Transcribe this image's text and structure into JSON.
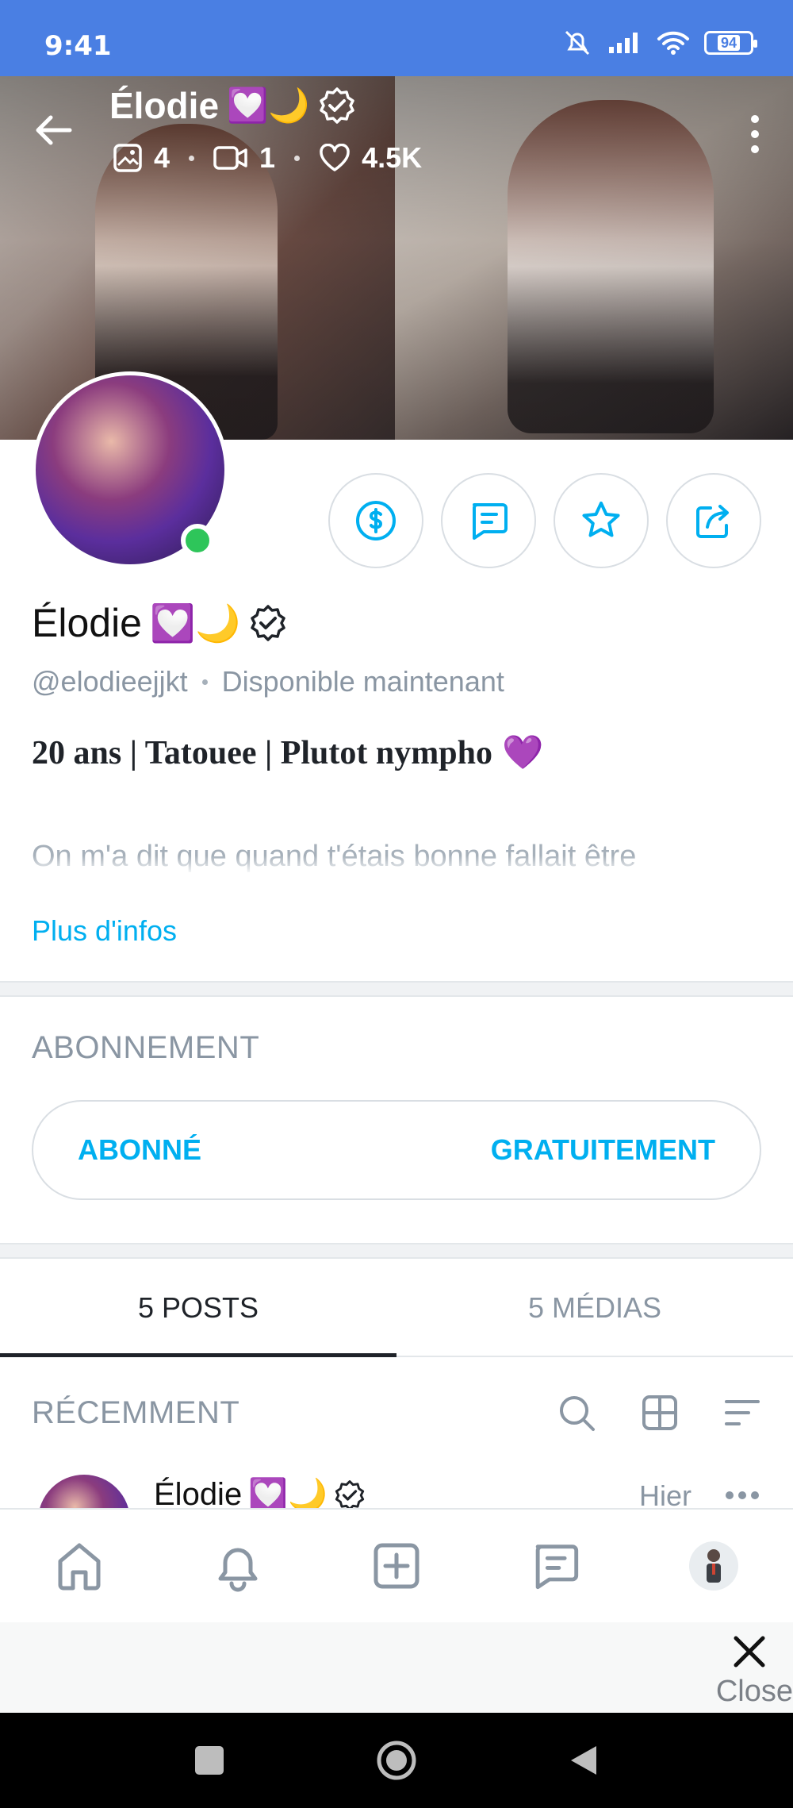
{
  "status_bar": {
    "time": "9:41",
    "battery": "94",
    "icons": [
      "mute-icon",
      "signal-icon",
      "wifi-icon",
      "battery-icon"
    ]
  },
  "cover": {
    "title_name": "Élodie",
    "title_emojis": "💟🌙",
    "stats": {
      "photos": "4",
      "videos": "1",
      "likes": "4.5K"
    }
  },
  "profile": {
    "name": "Élodie",
    "emojis": "💟🌙",
    "handle": "@elodieejjkt",
    "status": "Disponible maintenant",
    "bio_line1": "20 ans | Tatouee | Plutot nympho",
    "bio_emoji": "💜",
    "bio_line2": "On m'a dit que quand t'étais bonne fallait être",
    "more_info": "Plus d'infos"
  },
  "subscription": {
    "section_title": "ABONNEMENT",
    "left_label": "ABONNÉ",
    "right_label": "GRATUITEMENT"
  },
  "tabs": [
    {
      "label": "5 POSTS",
      "active": true
    },
    {
      "label": "5 MÉDIAS",
      "active": false
    }
  ],
  "recent": {
    "title": "RÉCEMMENT",
    "icons": [
      "search-icon",
      "grid-icon",
      "sort-icon"
    ]
  },
  "post_preview": {
    "name": "Élodie",
    "emojis": "💟🌙",
    "time": "Hier"
  },
  "bottom_nav": {
    "icons": [
      "home-icon",
      "bell-icon",
      "add-post-icon",
      "messages-icon",
      "profile-avatar"
    ]
  },
  "ad": {
    "close_label": "Close"
  },
  "colors": {
    "status_bar": "#4a7fe3",
    "accent": "#00aff0",
    "muted": "#8a96a3",
    "online": "#2ec55a"
  }
}
